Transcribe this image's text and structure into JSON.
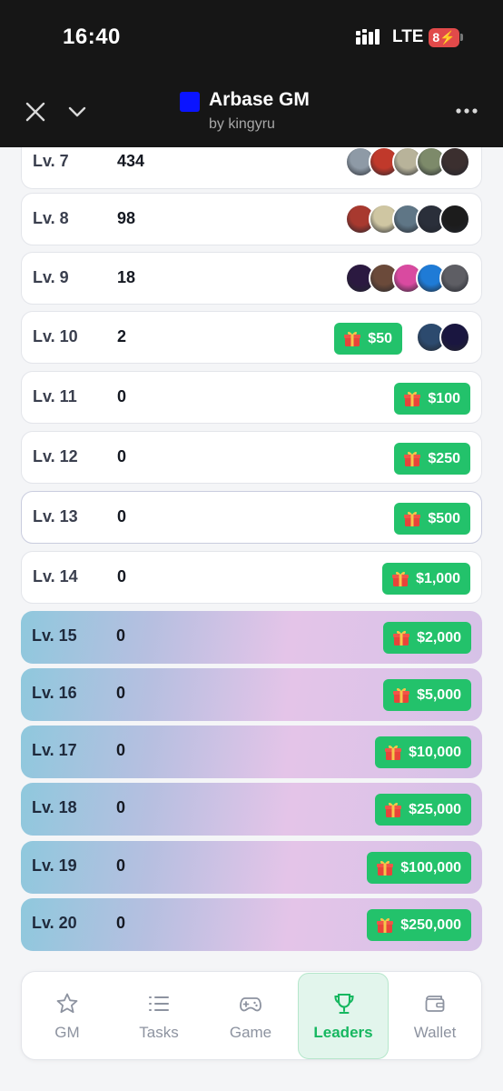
{
  "status_bar": {
    "time": "16:40",
    "network": "LTE",
    "battery": "8"
  },
  "header": {
    "title": "Arbase GM",
    "subtitle": "by kingyru",
    "brand_color": "#0a14ff"
  },
  "levels": [
    {
      "level": "Lv. 7",
      "count": "434",
      "avatars": [
        "#8e9aa6",
        "#c0392b",
        "#b8b39a",
        "#7d8a6a",
        "#3b2f2f"
      ]
    },
    {
      "level": "Lv. 8",
      "count": "98",
      "avatars": [
        "#a8392f",
        "#cfc6a2",
        "#5f7686",
        "#2a2f3a",
        "#1c1c1c"
      ]
    },
    {
      "level": "Lv. 9",
      "count": "18",
      "avatars": [
        "#2b1940",
        "#6b4a3a",
        "#d94aa0",
        "#1f7bd6",
        "#5e5e64"
      ]
    },
    {
      "level": "Lv. 10",
      "count": "2",
      "reward": "$50",
      "avatars": [
        "#2c4a6e",
        "#1a1640"
      ]
    },
    {
      "level": "Lv. 11",
      "count": "0",
      "reward": "$100"
    },
    {
      "level": "Lv. 12",
      "count": "0",
      "reward": "$250"
    },
    {
      "level": "Lv. 13",
      "count": "0",
      "reward": "$500"
    },
    {
      "level": "Lv. 14",
      "count": "0",
      "reward": "$1,000"
    },
    {
      "level": "Lv. 15",
      "count": "0",
      "reward": "$2,000"
    },
    {
      "level": "Lv. 16",
      "count": "0",
      "reward": "$5,000"
    },
    {
      "level": "Lv. 17",
      "count": "0",
      "reward": "$10,000"
    },
    {
      "level": "Lv. 18",
      "count": "0",
      "reward": "$25,000"
    },
    {
      "level": "Lv. 19",
      "count": "0",
      "reward": "$100,000"
    },
    {
      "level": "Lv. 20",
      "count": "0",
      "reward": "$250,000"
    }
  ],
  "nav": {
    "tabs": [
      {
        "label": "GM",
        "icon": "star-icon"
      },
      {
        "label": "Tasks",
        "icon": "list-icon"
      },
      {
        "label": "Game",
        "icon": "gamepad-icon"
      },
      {
        "label": "Leaders",
        "icon": "trophy-icon"
      },
      {
        "label": "Wallet",
        "icon": "wallet-icon"
      }
    ],
    "active": "Leaders"
  },
  "colors": {
    "reward_green": "#23c26b",
    "active_tab": "#16b760"
  }
}
